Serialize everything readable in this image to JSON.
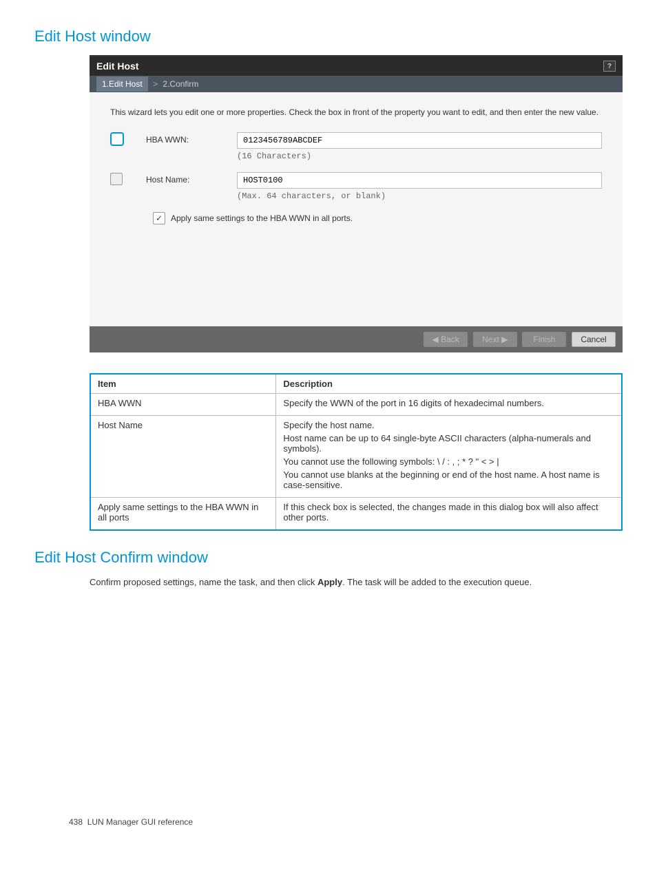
{
  "section1_title": "Edit Host window",
  "wizard": {
    "title": "Edit Host",
    "steps": {
      "step1": "1.Edit Host",
      "step2": "2.Confirm"
    },
    "instruction": "This wizard lets you edit one or more properties. Check the box in front of the property you want to edit, and then enter the new value.",
    "hba_label": "HBA WWN:",
    "hba_value": "0123456789ABCDEF",
    "hba_hint": "(16 Characters)",
    "host_label": "Host Name:",
    "host_value": "HOST0100",
    "host_hint": "(Max. 64 characters, or blank)",
    "apply_label": "Apply same settings to the HBA WWN in all ports.",
    "buttons": {
      "back": "◀ Back",
      "next": "Next ▶",
      "finish": "Finish",
      "cancel": "Cancel"
    }
  },
  "table": {
    "headers": {
      "item": "Item",
      "desc": "Description"
    },
    "rows": [
      {
        "item": "HBA WWN",
        "desc": [
          "Specify the WWN of the port in 16 digits of hexadecimal numbers."
        ]
      },
      {
        "item": "Host Name",
        "desc": [
          "Specify the host name.",
          "Host name can be up to 64 single-byte ASCII characters (alpha-numerals and symbols).",
          "You cannot use the following symbols: \\ / : , ; * ? \" < > |",
          "You cannot use blanks at the beginning or end of the host name. A host name is case-sensitive."
        ]
      },
      {
        "item": "Apply same settings to the HBA WWN in all ports",
        "desc": [
          "If this check box is selected, the changes made in this dialog box will also affect other ports."
        ]
      }
    ]
  },
  "section2_title": "Edit Host Confirm window",
  "confirm_text_pre": "Confirm proposed settings, name the task, and then click ",
  "confirm_text_strong": "Apply",
  "confirm_text_post": ". The task will be added to the execution queue.",
  "footer": {
    "page": "438",
    "ref": "LUN Manager GUI reference"
  }
}
